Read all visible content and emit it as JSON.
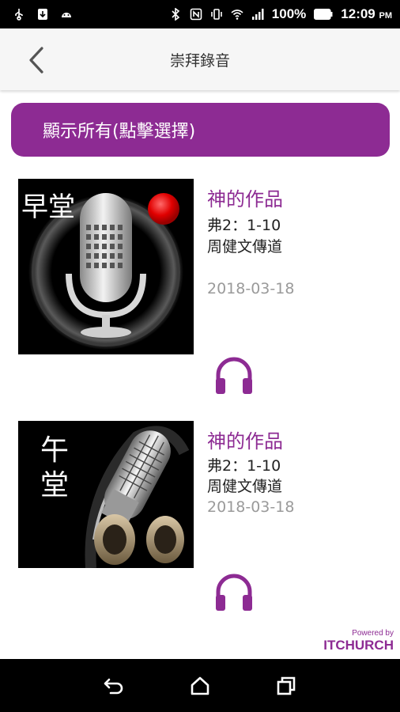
{
  "status_bar": {
    "battery": "100%",
    "time": "12:09",
    "ampm": "PM",
    "icons": [
      "usb-icon",
      "download-icon",
      "android-icon",
      "bluetooth-icon",
      "nfc-icon",
      "vibrate-icon",
      "wifi-icon",
      "signal-icon",
      "battery-icon"
    ]
  },
  "app_bar": {
    "title": "崇拜錄音"
  },
  "filter": {
    "label": "顯示所有(點擊選擇)"
  },
  "items": [
    {
      "thumb_label": "早堂",
      "title": "神的作品",
      "verse": "弗2：1-10",
      "speaker": "周健文傳道",
      "date": "2018-03-18"
    },
    {
      "thumb_label_line1": "午",
      "thumb_label_line2": "堂",
      "title": "神的作品",
      "verse": "弗2：1-10",
      "speaker": "周健文傳道",
      "date": "2018-03-18"
    }
  ],
  "footer": {
    "powered_by": "Powered by",
    "brand": "ITCHURCH"
  },
  "colors": {
    "accent": "#8d2b93",
    "date_gray": "#9a9a9a"
  }
}
